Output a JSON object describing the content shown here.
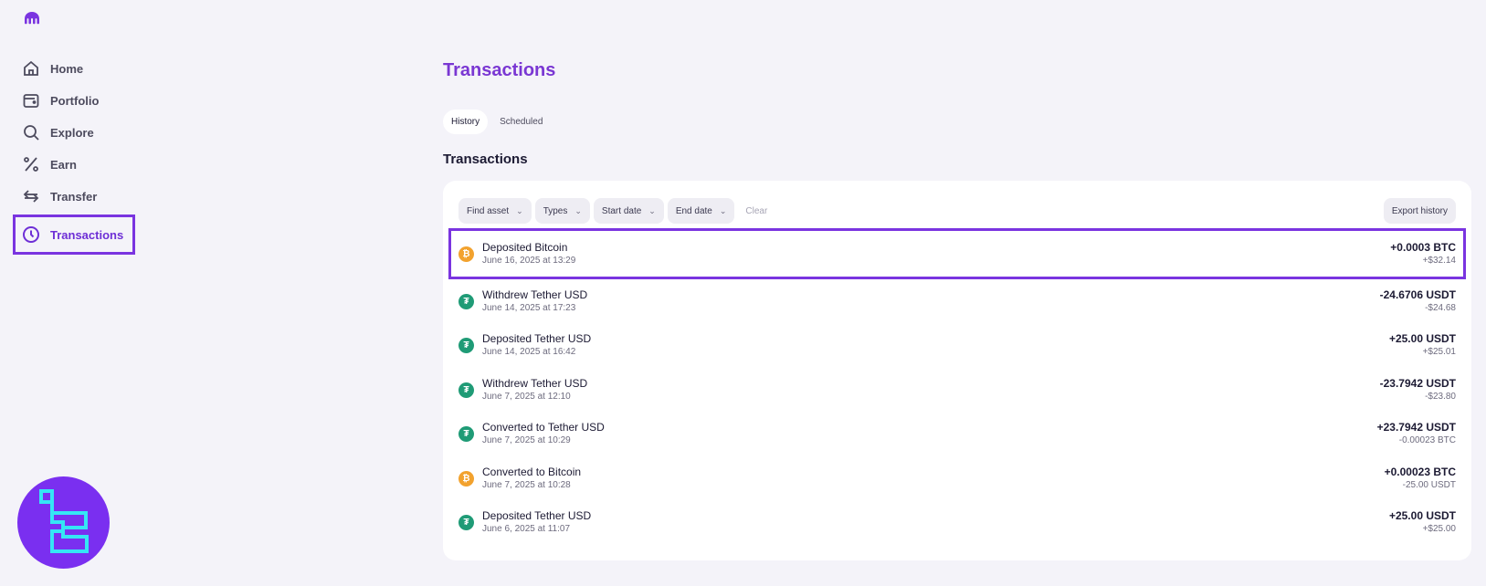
{
  "sidebar": {
    "items": [
      {
        "label": "Home",
        "icon": "home-icon"
      },
      {
        "label": "Portfolio",
        "icon": "wallet-icon"
      },
      {
        "label": "Explore",
        "icon": "search-icon"
      },
      {
        "label": "Earn",
        "icon": "percent-icon"
      },
      {
        "label": "Transfer",
        "icon": "transfer-icon"
      },
      {
        "label": "Transactions",
        "icon": "clock-icon"
      }
    ]
  },
  "main": {
    "title": "Transactions",
    "tabs": [
      {
        "label": "History"
      },
      {
        "label": "Scheduled"
      }
    ],
    "section_title": "Transactions",
    "filters": {
      "find_asset": "Find asset",
      "types": "Types",
      "start_date": "Start date",
      "end_date": "End date",
      "clear": "Clear",
      "export": "Export history"
    },
    "transactions": [
      {
        "title": "Deposited Bitcoin",
        "date": "June 16, 2025 at 13:29",
        "amount": "+0.0003 BTC",
        "sub": "+$32.14",
        "coin": "btc"
      },
      {
        "title": "Withdrew Tether USD",
        "date": "June 14, 2025 at 17:23",
        "amount": "-24.6706 USDT",
        "sub": "-$24.68",
        "coin": "usdt"
      },
      {
        "title": "Deposited Tether USD",
        "date": "June 14, 2025 at 16:42",
        "amount": "+25.00 USDT",
        "sub": "+$25.01",
        "coin": "usdt"
      },
      {
        "title": "Withdrew Tether USD",
        "date": "June 7, 2025 at 12:10",
        "amount": "-23.7942 USDT",
        "sub": "-$23.80",
        "coin": "usdt"
      },
      {
        "title": "Converted to Tether USD",
        "date": "June 7, 2025 at 10:29",
        "amount": "+23.7942 USDT",
        "sub": "-0.00023 BTC",
        "coin": "usdt"
      },
      {
        "title": "Converted to Bitcoin",
        "date": "June 7, 2025 at 10:28",
        "amount": "+0.00023 BTC",
        "sub": "-25.00 USDT",
        "coin": "btc"
      },
      {
        "title": "Deposited Tether USD",
        "date": "June 6, 2025 at 11:07",
        "amount": "+25.00 USDT",
        "sub": "+$25.00",
        "coin": "usdt"
      }
    ]
  },
  "colors": {
    "accent": "#7a34e0",
    "btc": "#f2a22e",
    "usdt": "#1f9b76"
  }
}
